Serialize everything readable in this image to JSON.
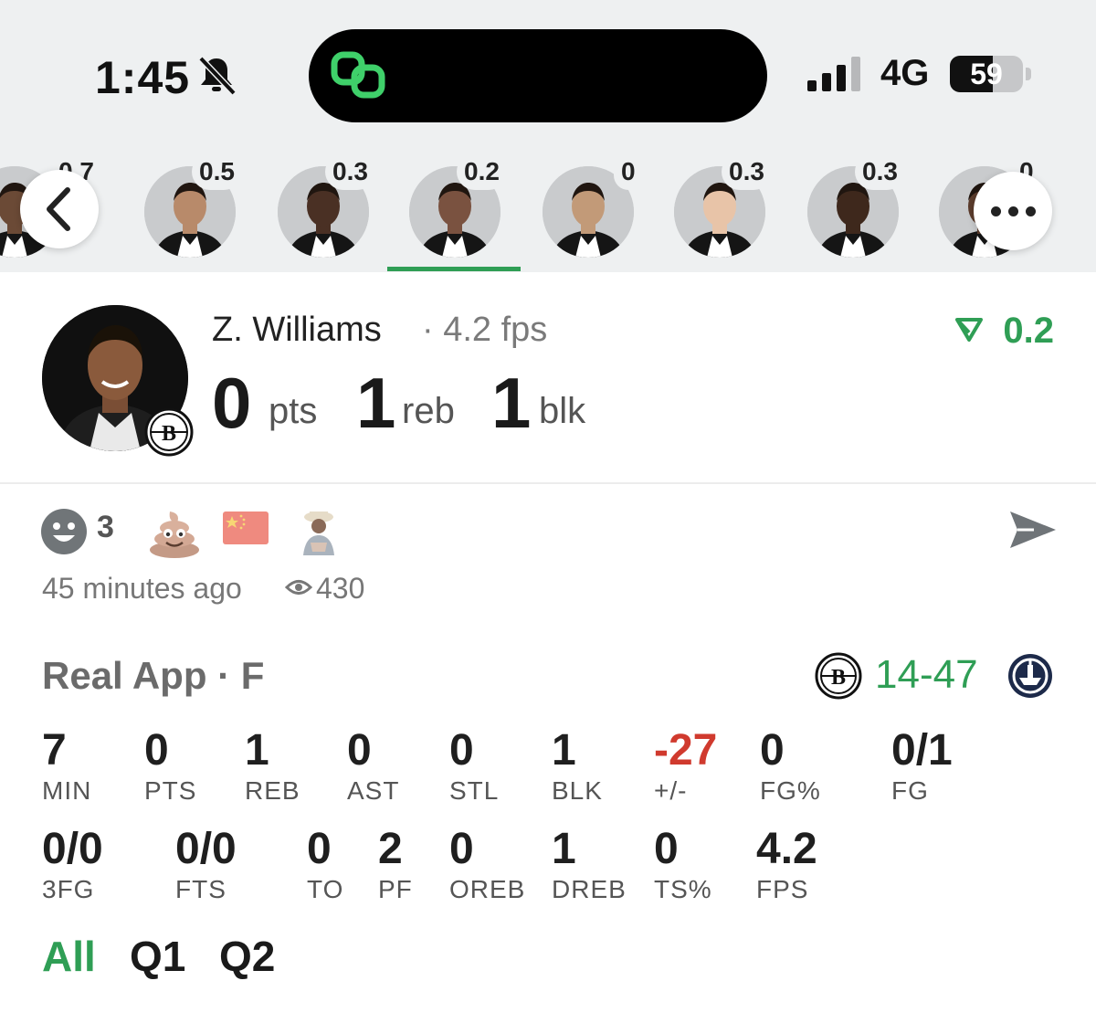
{
  "status_bar": {
    "time": "1:45",
    "network": "4G",
    "battery": "59",
    "battery_level": 0.59
  },
  "carousel": {
    "players": [
      {
        "score": "0.7"
      },
      {
        "score": "0.5"
      },
      {
        "score": "0.3"
      },
      {
        "score": "0.2"
      },
      {
        "score": "0"
      },
      {
        "score": "0.3"
      },
      {
        "score": "0.3"
      },
      {
        "score": "0"
      }
    ],
    "selected_index": 3
  },
  "player": {
    "name": "Z. Williams",
    "fps_label": "· 4.2 fps",
    "delta": "0.2",
    "stats": [
      {
        "value": "0",
        "unit": "pts"
      },
      {
        "value": "1",
        "unit": "reb"
      },
      {
        "value": "1",
        "unit": "blk"
      }
    ]
  },
  "reactions": {
    "smiley_count": "3",
    "time_ago": "45 minutes ago",
    "views": "430"
  },
  "game": {
    "title": "Real App · F",
    "score": "14-47",
    "colors": {
      "green": "#2f9e55",
      "red": "#d03a2e"
    },
    "row1": [
      {
        "value": "7",
        "label": "MIN"
      },
      {
        "value": "0",
        "label": "PTS"
      },
      {
        "value": "1",
        "label": "REB"
      },
      {
        "value": "0",
        "label": "AST"
      },
      {
        "value": "0",
        "label": "STL"
      },
      {
        "value": "1",
        "label": "BLK"
      },
      {
        "value": "-27",
        "label": "+/-"
      },
      {
        "value": "0",
        "label": "FG%"
      },
      {
        "value": "0/1",
        "label": "FG"
      }
    ],
    "row2": [
      {
        "value": "0/0",
        "label": "3FG"
      },
      {
        "value": "0/0",
        "label": "FTS"
      },
      {
        "value": "0",
        "label": "TO"
      },
      {
        "value": "2",
        "label": "PF"
      },
      {
        "value": "0",
        "label": "OREB"
      },
      {
        "value": "1",
        "label": "DREB"
      },
      {
        "value": "0",
        "label": "TS%"
      },
      {
        "value": "4.2",
        "label": "FPS"
      }
    ]
  },
  "tabs": {
    "all": "All",
    "q1": "Q1",
    "q2": "Q2"
  }
}
